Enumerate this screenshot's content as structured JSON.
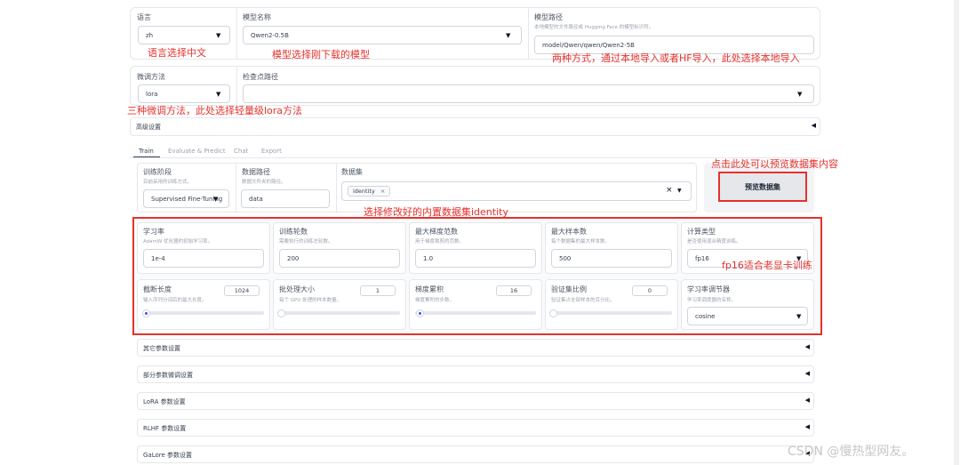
{
  "top": {
    "language": {
      "label": "语言",
      "value": "zh"
    },
    "model_name": {
      "label": "模型名称",
      "value": "Qwen2-0.5B"
    },
    "model_path": {
      "label": "模型路径",
      "sub": "本地模型的文件路径或 Hugging Face 的模型标识符。",
      "value": "model/Qwen/qwen/Qwen2-5B"
    },
    "finetune": {
      "label": "微调方法",
      "value": "lora"
    },
    "checkpoint": {
      "label": "检查点路径",
      "value": ""
    },
    "advanced": "高级设置"
  },
  "tabs": [
    "Train",
    "Evaluate & Predict",
    "Chat",
    "Export"
  ],
  "train": {
    "stage": {
      "label": "训练阶段",
      "sub": "目前采用的训练方式。",
      "value": "Supervised Fine-Tuning"
    },
    "data_dir": {
      "label": "数据路径",
      "sub": "数据文件夹的路径。",
      "value": "data"
    },
    "dataset": {
      "label": "数据集",
      "chip": "identity",
      "chip_x": "×",
      "clear": "×"
    },
    "preview_button": "预览数据集"
  },
  "params_row1": [
    {
      "label": "学习率",
      "sub": "AdamW 优化器的初始学习率。",
      "value": "1e-4"
    },
    {
      "label": "训练轮数",
      "sub": "需要执行的训练总轮数。",
      "value": "200"
    },
    {
      "label": "最大梯度范数",
      "sub": "用于梯度裁剪的范数。",
      "value": "1.0"
    },
    {
      "label": "最大样本数",
      "sub": "每个数据集的最大样本数。",
      "value": "500"
    },
    {
      "label": "计算类型",
      "sub": "是否使用混合精度训练。",
      "value": "fp16"
    }
  ],
  "params_row2": [
    {
      "label": "截断长度",
      "sub": "输入序列分词后的最大长度。",
      "value": "1024",
      "level": 0.01
    },
    {
      "label": "批处理大小",
      "sub": "每个 GPU 处理的样本数量。",
      "value": "1",
      "level": 0.0
    },
    {
      "label": "梯度累积",
      "sub": "梯度累积的步数。",
      "value": "16",
      "level": 0.02
    },
    {
      "label": "验证集比例",
      "sub": "验证集占全部样本的百分比。",
      "value": "0",
      "level": 0.0
    },
    {
      "label": "学习率调节器",
      "sub": "学习率调度器的名称。",
      "value": "cosine"
    }
  ],
  "accordions": [
    "其它参数设置",
    "部分参数微调设置",
    "LoRA 参数设置",
    "RLHF 参数设置",
    "GaLore 参数设置"
  ],
  "annotations": {
    "lang": "语言选择中文",
    "model": "模型选择刚下载的模型",
    "path": "两种方式，通过本地导入或者HF导入，此处选择本地导入",
    "method": "三种微调方法，此处选择轻量级lora方法",
    "preview": "点击此处可以预览数据集内容",
    "dataset": "选择修改好的内置数据集identity",
    "fp16": "fp16适合老显卡训练"
  },
  "watermark": "CSDN @慢热型网友。",
  "colors": {
    "annotation": "#e5322d",
    "accent": "#4f46e5"
  }
}
